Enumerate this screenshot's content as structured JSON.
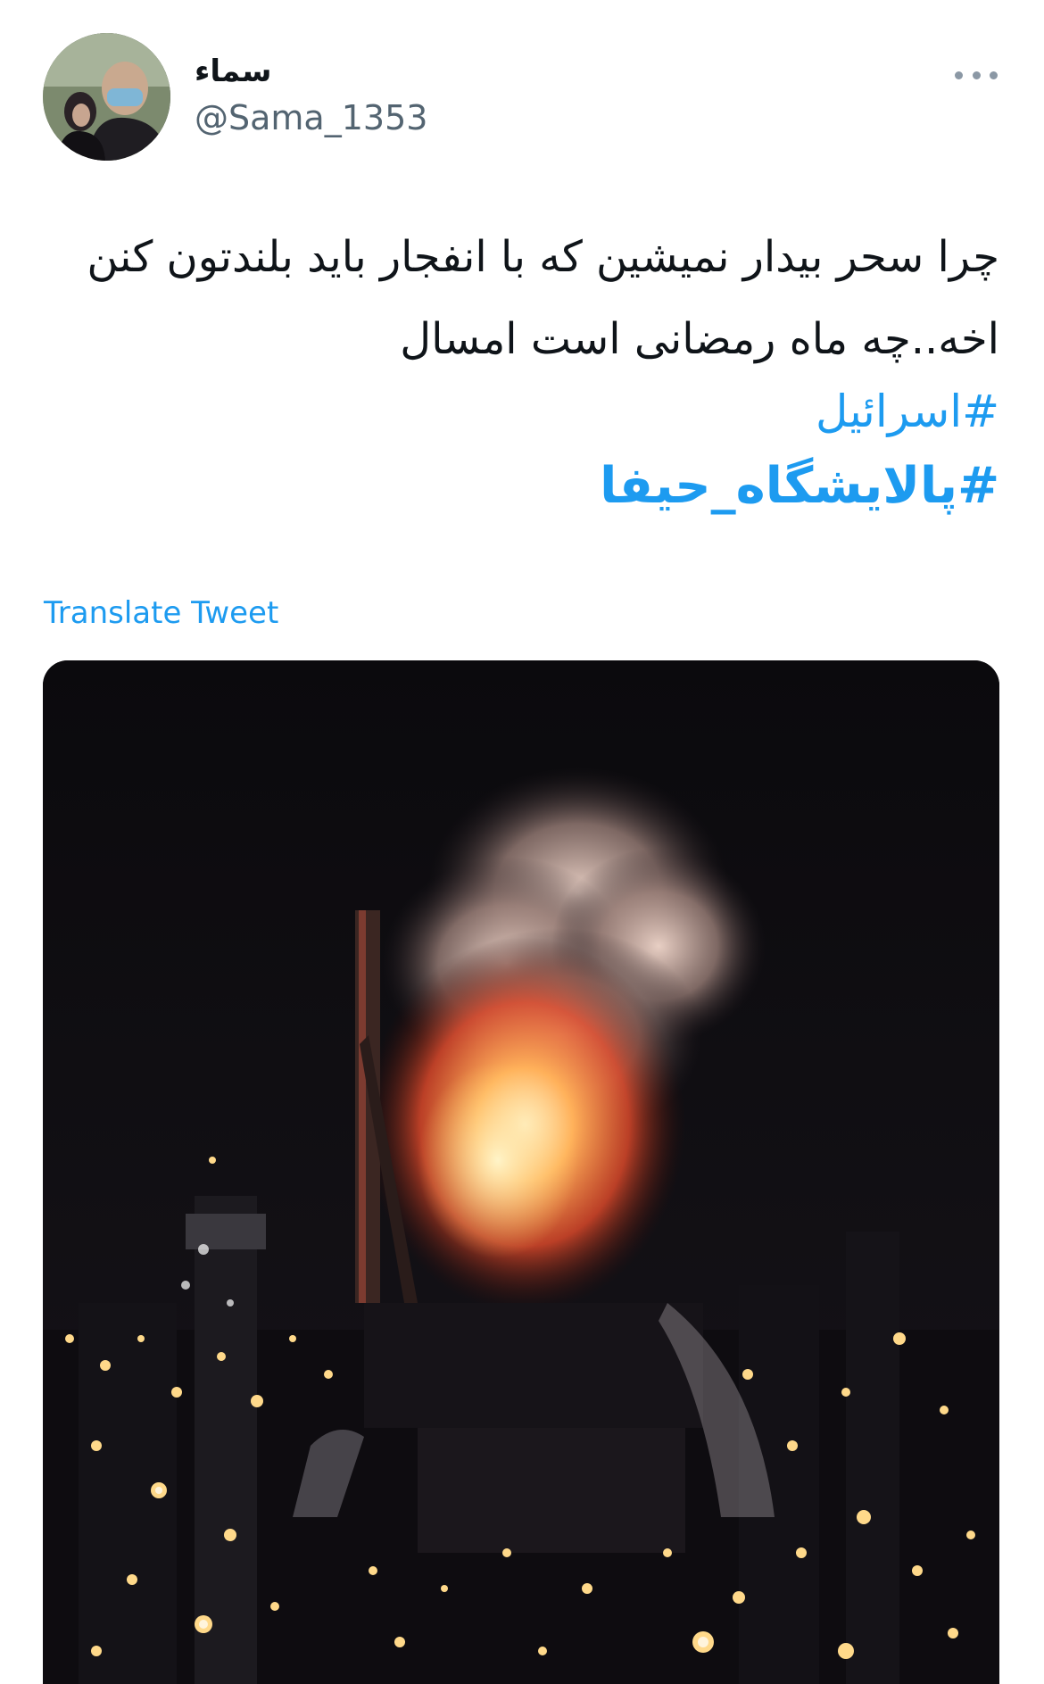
{
  "tweet": {
    "author": {
      "display_name": "سماء",
      "handle": "@Sama_1353",
      "avatar_icon": "profile-photo"
    },
    "text": "چرا سحر بیدار نمیشین که با انفجار باید بلندتون کنن اخه..چه ماه رمضانی است امسال",
    "hashtags": [
      "#اسرائیل",
      "#پالایشگاه_حیفا"
    ],
    "translate_label": "Translate Tweet",
    "more_icon": "more-horizontal-icon",
    "media_description_icon": "tweet-photo"
  },
  "colors": {
    "link": "#1d9bf0",
    "text": "#0f1419",
    "secondary": "#536471"
  }
}
